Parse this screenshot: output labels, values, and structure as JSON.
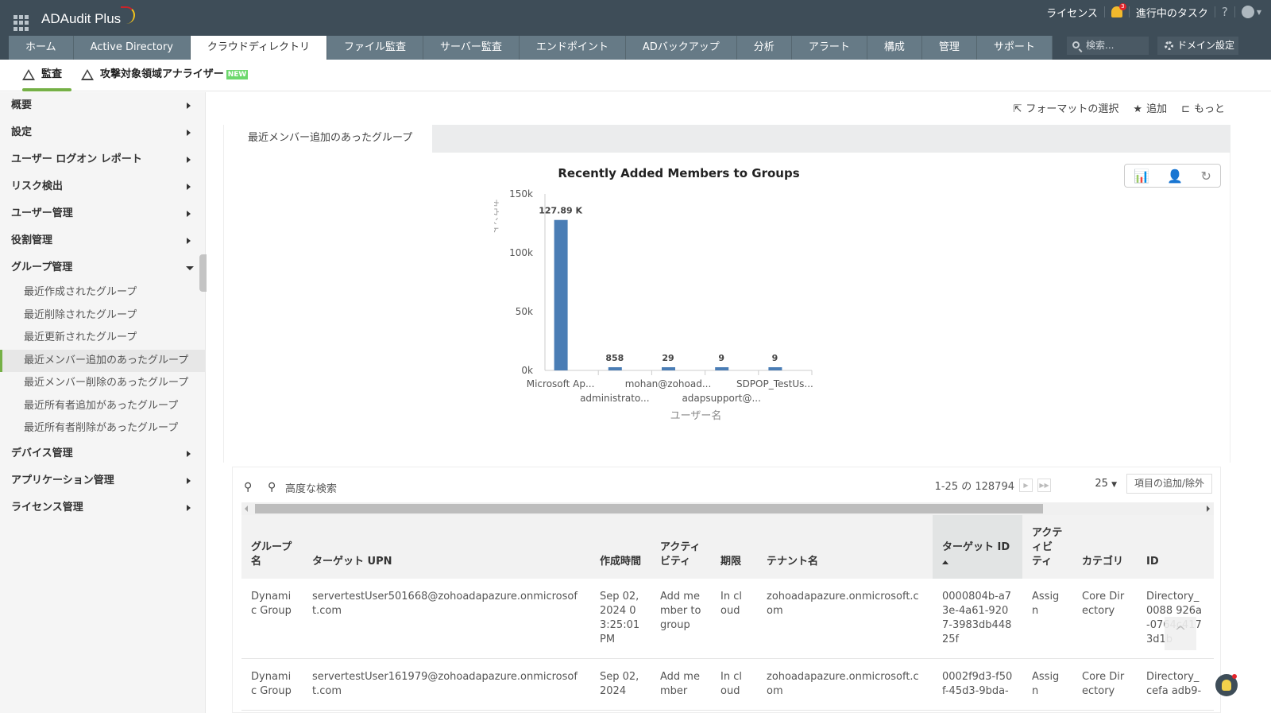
{
  "header": {
    "app_name": "ADAudit Plus",
    "license": "ライセンス",
    "notification_count": "3",
    "tasks": "進行中のタスク",
    "help": "?",
    "search_placeholder": "検索...",
    "domain_settings": "ドメイン設定"
  },
  "nav": {
    "tabs": [
      {
        "label": "ホーム",
        "active": false
      },
      {
        "label": "Active Directory",
        "active": false
      },
      {
        "label": "クラウドディレクトリ",
        "active": true
      },
      {
        "label": "ファイル監査",
        "active": false
      },
      {
        "label": "サーバー監査",
        "active": false
      },
      {
        "label": "エンドポイント",
        "active": false
      },
      {
        "label": "ADバックアップ",
        "active": false
      },
      {
        "label": "分析",
        "active": false
      },
      {
        "label": "アラート",
        "active": false
      },
      {
        "label": "構成",
        "active": false
      },
      {
        "label": "管理",
        "active": false
      },
      {
        "label": "サポート",
        "active": false
      }
    ]
  },
  "subtabs": {
    "audit": "監査",
    "analyzer": "攻撃対象領域アナライザー",
    "new_badge": "NEW"
  },
  "sidebar": {
    "items": [
      {
        "label": "概要",
        "expanded": false
      },
      {
        "label": "設定",
        "expanded": false
      },
      {
        "label": "ユーザー ログオン レポート",
        "expanded": false
      },
      {
        "label": "リスク検出",
        "expanded": false
      },
      {
        "label": "ユーザー管理",
        "expanded": false
      },
      {
        "label": "役割管理",
        "expanded": false
      },
      {
        "label": "グループ管理",
        "expanded": true
      }
    ],
    "group_sub_items": [
      {
        "label": "最近作成されたグループ",
        "active": false
      },
      {
        "label": "最近削除されたグループ",
        "active": false
      },
      {
        "label": "最近更新されたグループ",
        "active": false
      },
      {
        "label": "最近メンバー追加のあったグループ",
        "active": true
      },
      {
        "label": "最近メンバー削除のあったグループ",
        "active": false
      },
      {
        "label": "最近所有者追加があったグループ",
        "active": false
      },
      {
        "label": "最近所有者削除があったグループ",
        "active": false
      }
    ],
    "items_after": [
      {
        "label": "デバイス管理"
      },
      {
        "label": "アプリケーション管理"
      },
      {
        "label": "ライセンス管理"
      }
    ]
  },
  "toolbar": {
    "format": "フォーマットの選択",
    "add": "追加",
    "more": "もっと"
  },
  "report": {
    "tab_label": "最近メンバー追加のあったグループ"
  },
  "chart_data": {
    "type": "bar",
    "title": "Recently Added Members to Groups",
    "xlabel": "ユーザー名",
    "ylabel": "カウント",
    "categories": [
      "Microsoft Ap...",
      "administrato...",
      "mohan@zohoad...",
      "adapsupport@...",
      "SDPOP_TestUs..."
    ],
    "values": [
      127890,
      858,
      29,
      9,
      9
    ],
    "data_labels": [
      "127.89 K",
      "858",
      "29",
      "9",
      "9"
    ],
    "yticks": [
      "0k",
      "50k",
      "100k",
      "150k"
    ],
    "ylim": [
      0,
      150000
    ],
    "bar_color": "#4a7db5",
    "grid": false
  },
  "table": {
    "advanced_search": "高度な検索",
    "pager_text": "1-25 の 128794",
    "per_page": "25",
    "columns_button": "項目の追加/除外",
    "columns": [
      "グループ名",
      "ターゲット UPN",
      "作成時間",
      "アクティビティ",
      "期限",
      "テナント名",
      "ターゲット ID",
      "アクティビティ",
      "カテゴリ",
      "ID"
    ],
    "sorted_column": "ターゲット ID",
    "rows": [
      [
        "Dynamic Group",
        "servertestUser501668@zohoadapazure.onmicrosoft.com",
        "Sep 02,2024 03:25:01 PM",
        "Add member to group",
        "In cloud",
        "zohoadapazure.onmicrosoft.com",
        "0000804b-a73e-4a61-9207-3983db44825f",
        "Assign",
        "Core Directory",
        "Directory_0088 926a-0764c4173d1b"
      ],
      [
        "Dynamic Group",
        "servertestUser161979@zohoadapazure.onmicrosoft.com",
        "Sep 02,2024",
        "Add member",
        "In cloud",
        "zohoadapazure.onmicrosoft.com",
        "0002f9d3-f50f-45d3-9bda-",
        "Assign",
        "Core Directory",
        "Directory_cefa adb9-"
      ]
    ]
  }
}
